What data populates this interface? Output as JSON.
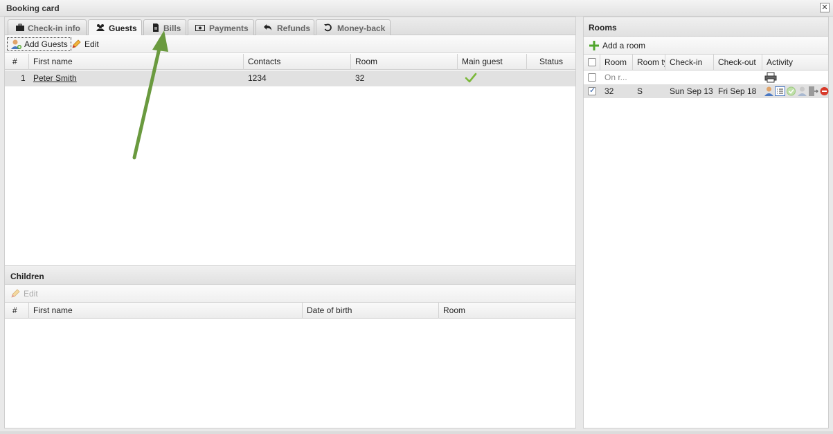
{
  "window": {
    "title": "Booking card",
    "close_label": "✕"
  },
  "tabs": [
    {
      "label": "Check-in info",
      "icon": "briefcase-icon",
      "active": false
    },
    {
      "label": "Guests",
      "icon": "users-icon",
      "active": true
    },
    {
      "label": "Bills",
      "icon": "document-icon",
      "active": false
    },
    {
      "label": "Payments",
      "icon": "money-icon",
      "active": false
    },
    {
      "label": "Refunds",
      "icon": "undo-arrow-icon",
      "active": false
    },
    {
      "label": "Money-back",
      "icon": "rotate-icon",
      "active": false
    }
  ],
  "guests": {
    "toolbar": {
      "add_label": "Add Guests",
      "edit_label": "Edit"
    },
    "columns": [
      "#",
      "First name",
      "Contacts",
      "Room",
      "Main guest",
      "Status"
    ],
    "rows": [
      {
        "num": "1",
        "first_name": "Peter Smith",
        "contacts": "1234",
        "room": "32",
        "main_guest": true,
        "status": ""
      }
    ]
  },
  "children": {
    "title": "Children",
    "toolbar": {
      "edit_label": "Edit"
    },
    "columns": [
      "#",
      "First name",
      "Date of birth",
      "Room"
    ],
    "rows": []
  },
  "rooms": {
    "title": "Rooms",
    "toolbar": {
      "add_label": "Add a room"
    },
    "columns": [
      "",
      "Room",
      "Room ty",
      "Check-in",
      "Check-out",
      "Activity"
    ],
    "rows": [
      {
        "checked": false,
        "room": "On r...",
        "room_type": "",
        "check_in": "",
        "check_out": "",
        "activity": [
          "printer-icon"
        ]
      },
      {
        "checked": true,
        "room": "32",
        "room_type": "S",
        "check_in": "Sun Sep 13",
        "check_out": "Fri Sep 18",
        "activity": [
          "guest-icon",
          "list-icon",
          "check-circle-icon",
          "user-gray-icon",
          "door-exit-icon",
          "cancel-icon"
        ]
      }
    ]
  },
  "colors": {
    "annotation_arrow": "#6a9a3f",
    "accent_green": "#4fa52c",
    "cancel_red": "#d83a2a"
  }
}
